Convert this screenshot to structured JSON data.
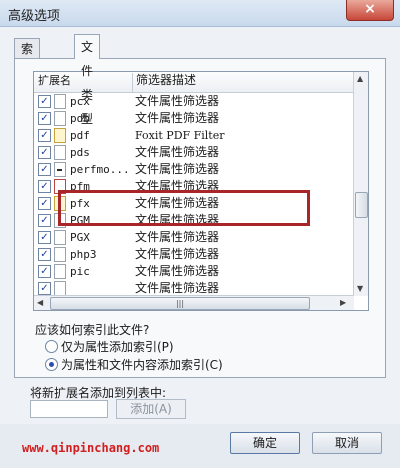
{
  "window": {
    "title": "高级选项",
    "close_glyph": "×"
  },
  "tabs": [
    {
      "label": "索引设置",
      "active": false
    },
    {
      "label": "文件类型",
      "active": true
    }
  ],
  "list": {
    "columns": {
      "ext": "扩展名",
      "desc": "筛选器描述"
    },
    "rows": [
      {
        "ext": "pcx",
        "desc": "文件属性筛选器",
        "checked": true,
        "icon": "file-icon"
      },
      {
        "ext": "pdb",
        "desc": "文件属性筛选器",
        "checked": true,
        "icon": "file-icon"
      },
      {
        "ext": "pdf",
        "desc": "Foxit PDF Filter",
        "checked": true,
        "icon": "pdf-file-icon"
      },
      {
        "ext": "pds",
        "desc": "文件属性筛选器",
        "checked": true,
        "icon": "file-icon"
      },
      {
        "ext": "perfmo...",
        "desc": "文件属性筛选器",
        "checked": true,
        "icon": "perfmon-file-icon"
      },
      {
        "ext": "pfm",
        "desc": "文件属性筛选器",
        "checked": true,
        "icon": "font-file-icon"
      },
      {
        "ext": "pfx",
        "desc": "文件属性筛选器",
        "checked": true,
        "icon": "certificate-file-icon"
      },
      {
        "ext": "PGM",
        "desc": "文件属性筛选器",
        "checked": true,
        "icon": "file-icon"
      },
      {
        "ext": "PGX",
        "desc": "文件属性筛选器",
        "checked": true,
        "icon": "file-icon"
      },
      {
        "ext": "php3",
        "desc": "文件属性筛选器",
        "checked": true,
        "icon": "file-icon"
      },
      {
        "ext": "pic",
        "desc": "文件属性筛选器",
        "checked": true,
        "icon": "file-icon"
      },
      {
        "ext": "",
        "desc": "文件属性筛选器",
        "checked": true,
        "icon": "file-icon"
      }
    ],
    "check_glyph": "✓",
    "scroll_grip": "|||"
  },
  "index_group": {
    "label": "应该如何索引此文件?",
    "options": [
      {
        "label": "仅为属性添加索引(P)",
        "selected": false
      },
      {
        "label": "为属性和文件内容添加索引(C)",
        "selected": true
      }
    ]
  },
  "add_extension": {
    "label": "将新扩展名添加到列表中:",
    "value": "",
    "button": "添加(A)"
  },
  "footer": {
    "watermark": "www.qinpinchang.com",
    "ok": "确定",
    "cancel": "取消"
  },
  "colors": {
    "highlight_border": "#a8252a",
    "watermark": "#d21e1e"
  }
}
